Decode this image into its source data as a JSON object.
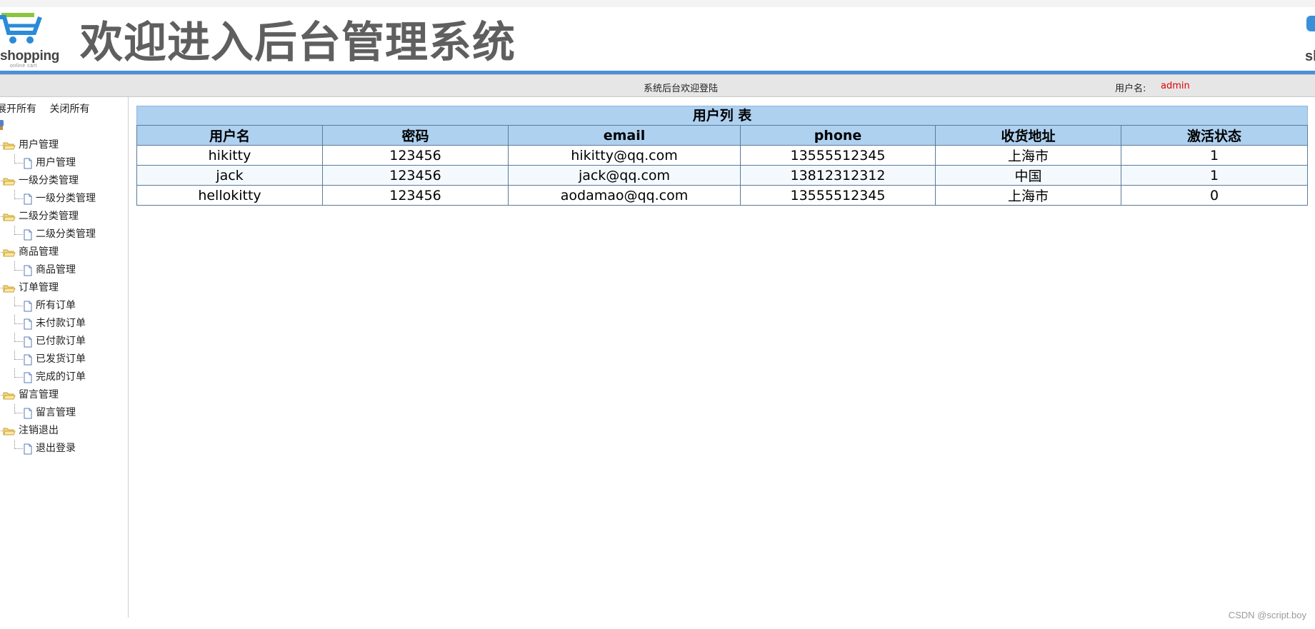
{
  "header": {
    "logo_text": "shopping",
    "logo_subtext": "online cart",
    "site_title": "欢迎进入后台管理系统",
    "right_logo_partial": "sl"
  },
  "status_bar": {
    "welcome": "系统后台欢迎登陆",
    "user_label": "用户名:",
    "user_name": "admin"
  },
  "sidebar": {
    "expand_all": "展开所有",
    "collapse_all": "关闭所有",
    "groups": [
      {
        "label": "用户管理",
        "items": [
          "用户管理"
        ]
      },
      {
        "label": "一级分类管理",
        "items": [
          "一级分类管理"
        ]
      },
      {
        "label": "二级分类管理",
        "items": [
          "二级分类管理"
        ]
      },
      {
        "label": "商品管理",
        "items": [
          "商品管理"
        ]
      },
      {
        "label": "订单管理",
        "items": [
          "所有订单",
          "未付款订单",
          "已付款订单",
          "已发货订单",
          "完成的订单"
        ]
      },
      {
        "label": "留言管理",
        "items": [
          "留言管理"
        ]
      },
      {
        "label": "注销退出",
        "items": [
          "退出登录"
        ]
      }
    ]
  },
  "user_table": {
    "caption": "用户列 表",
    "columns": [
      "用户名",
      "密码",
      "email",
      "phone",
      "收货地址",
      "激活状态"
    ],
    "rows": [
      [
        "hikitty",
        "123456",
        "hikitty@qq.com",
        "13555512345",
        "上海市",
        "1"
      ],
      [
        "jack",
        "123456",
        "jack@qq.com",
        "13812312312",
        "中国",
        "1"
      ],
      [
        "hellokitty",
        "123456",
        "aodamao@qq.com",
        "13555512345",
        "上海市",
        "0"
      ]
    ]
  },
  "watermark": "CSDN @script.boy",
  "colors": {
    "accent_blue": "#4a90d9",
    "table_header_bg": "#afd1f0",
    "username_red": "#e00000"
  }
}
